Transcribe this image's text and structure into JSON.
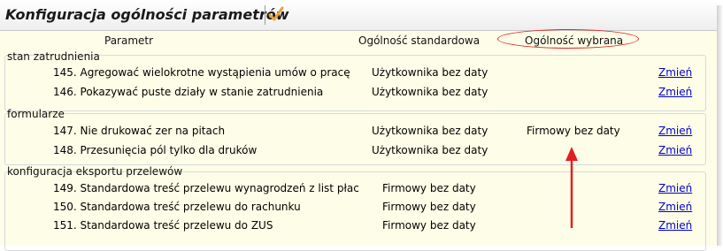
{
  "window": {
    "title": "Konfiguracja ogólności parametrów"
  },
  "icons": {
    "confirm": "check-icon",
    "confirm_color": "#e8a33a"
  },
  "columns": {
    "param": "Parametr",
    "standard": "Ogólność standardowa",
    "selected": "Ogólność wybrana"
  },
  "annotation_color": "#e02020",
  "groups": [
    {
      "label": "stan zatrudnienia",
      "rows": [
        {
          "param": "145. Agregować wielokrotne wystąpienia umów o pracę",
          "standard": "Użytkownika bez daty",
          "selected": "",
          "action": "Zmień"
        },
        {
          "param": "146. Pokazywać puste działy w stanie zatrudnienia",
          "standard": "Użytkownika bez daty",
          "selected": "",
          "action": "Zmień"
        }
      ]
    },
    {
      "label": "formularze",
      "rows": [
        {
          "param": "147. Nie drukować zer na pitach",
          "standard": "Użytkownika bez daty",
          "selected": "Firmowy bez daty",
          "action": "Zmień"
        },
        {
          "param": "148. Przesunięcia pól tylko dla druków",
          "standard": "Użytkownika bez daty",
          "selected": "",
          "action": "Zmień"
        }
      ]
    },
    {
      "label": "konfiguracja eksportu przelewów",
      "rows": [
        {
          "param": "149. Standardowa treść przelewu wynagrodzeń z list płac",
          "standard": "Firmowy bez daty",
          "selected": "",
          "action": "Zmień"
        },
        {
          "param": "150. Standardowa treść przelewu do rachunku",
          "standard": "Firmowy bez daty",
          "selected": "",
          "action": "Zmień"
        },
        {
          "param": "151. Standardowa treść przelewu do ZUS",
          "standard": "Firmowy bez daty",
          "selected": "",
          "action": "Zmień"
        }
      ]
    }
  ]
}
